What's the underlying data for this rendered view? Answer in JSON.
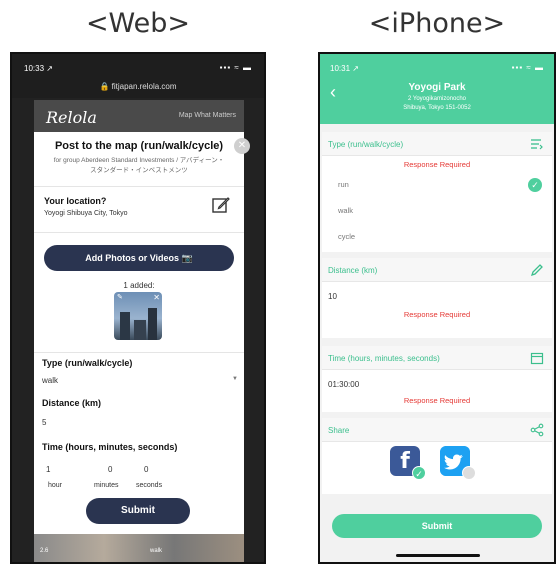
{
  "headings": {
    "web": "<Web>",
    "iphone": "<iPhone>"
  },
  "web": {
    "status_time": "10:33 ↗",
    "status_icons": "▪▪▪ ≈ ▬",
    "url": "🔒 fitjapan.relola.com",
    "banner_logo": "Relola",
    "banner_tagline": "Map What Matters",
    "post_title": "Post to the map (run/walk/cycle)",
    "close_symbol": "✕",
    "group_line1": "for group Aberdeen Standard Investments / アバディーン・",
    "group_line2": "スタンダード・インベストメンツ",
    "location_label": "Your location?",
    "location_value": "Yoyogi Shibuya City, Tokyo",
    "add_button": "Add Photos or Videos 📷",
    "added_text": "1 added:",
    "type_label": "Type (run/walk/cycle)",
    "type_value": "walk",
    "select_arrow": "▼",
    "distance_label": "Distance (km)",
    "distance_value": "5",
    "time_label": "Time (hours, minutes, seconds)",
    "time_hours": "1",
    "time_minutes": "0",
    "time_seconds": "0",
    "unit_hour": "hour",
    "unit_minutes": "minutes",
    "unit_seconds": "seconds",
    "submit": "Submit",
    "strip_left": "2.6",
    "strip_right": "walk"
  },
  "iphone": {
    "status_time": "10:31 ↗",
    "status_icons": "▪▪▪ ≈ ▬",
    "back_symbol": "‹",
    "place_title": "Yoyogi Park",
    "place_sub1": "2 Yoyogikamizonocho",
    "place_sub2": "Shibuya, Tokyo 151-0052",
    "type_label": "Type (run/walk/cycle)",
    "response_required": "Response Required",
    "options": [
      "run",
      "walk",
      "cycle"
    ],
    "selected_symbol": "✓",
    "distance_label": "Distance (km)",
    "distance_value": "10",
    "time_label": "Time (hours, minutes, seconds)",
    "time_value": "01:30:00",
    "share_label": "Share",
    "fb_letter": "f",
    "submit": "Submit"
  },
  "colors": {
    "web_button": "#2a3450",
    "iphone_accent": "#4fcf9e",
    "error_red": "#e53935",
    "facebook": "#3b5998",
    "twitter": "#1da1f2"
  }
}
